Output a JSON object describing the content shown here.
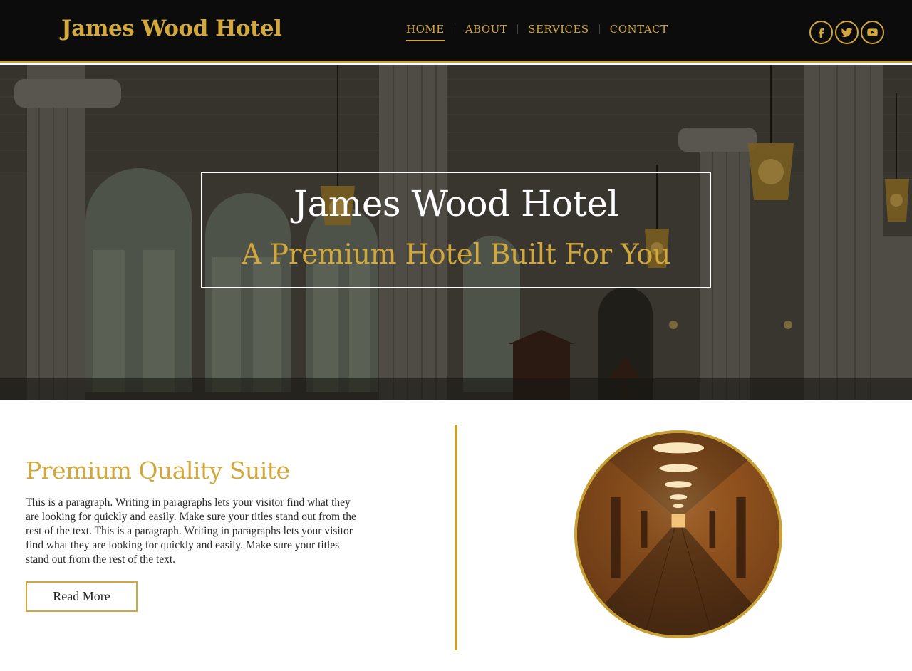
{
  "header": {
    "logo": "James Wood Hotel",
    "nav": [
      {
        "label": "HOME",
        "active": true
      },
      {
        "label": "ABOUT",
        "active": false
      },
      {
        "label": "SERVICES",
        "active": false
      },
      {
        "label": "CONTACT",
        "active": false
      }
    ],
    "social": [
      {
        "icon": "facebook-icon"
      },
      {
        "icon": "twitter-icon"
      },
      {
        "icon": "youtube-icon"
      }
    ]
  },
  "hero": {
    "title": "James Wood Hotel",
    "subtitle": "A Premium Hotel Built For You"
  },
  "section": {
    "title": "Premium Quality Suite",
    "paragraph": "This is a paragraph. Writing in paragraphs lets your visitor find what they are looking for quickly and easily. Make sure your titles stand out from the rest of the text. This is a paragraph. Writing in paragraphs lets your visitor find what they are looking for quickly and easily. Make sure your titles stand out from the rest of the text.",
    "button_label": "Read More"
  },
  "colors": {
    "accent": "#d2a83c",
    "header_bg": "#0c0c0c",
    "text": "#2a2a2a"
  }
}
